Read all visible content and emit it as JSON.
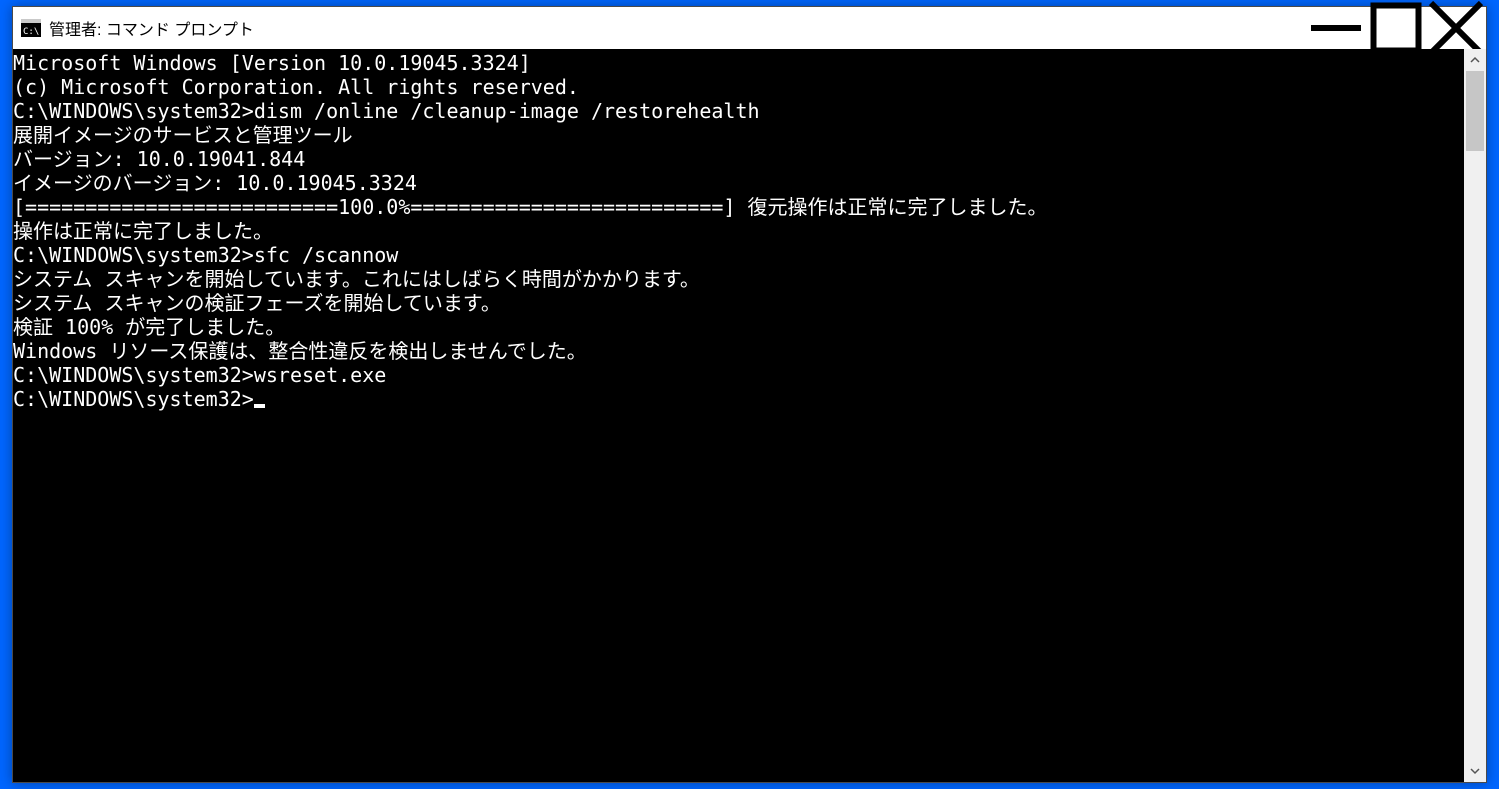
{
  "window": {
    "title": "管理者: コマンド プロンプト"
  },
  "terminal": {
    "lines": [
      "Microsoft Windows [Version 10.0.19045.3324]",
      "(c) Microsoft Corporation. All rights reserved.",
      "",
      "C:\\WINDOWS\\system32>dism /online /cleanup-image /restorehealth",
      "",
      "展開イメージのサービスと管理ツール",
      "バージョン: 10.0.19041.844",
      "",
      "イメージのバージョン: 10.0.19045.3324",
      "",
      "[==========================100.0%==========================] 復元操作は正常に完了しました。",
      "操作は正常に完了しました。",
      "",
      "C:\\WINDOWS\\system32>sfc /scannow",
      "",
      "システム スキャンを開始しています。これにはしばらく時間がかかります。",
      "",
      "システム スキャンの検証フェーズを開始しています。",
      "検証 100% が完了しました。",
      "",
      "Windows リソース保護は、整合性違反を検出しませんでした。",
      "",
      "C:\\WINDOWS\\system32>wsreset.exe",
      "",
      "C:\\WINDOWS\\system32>"
    ],
    "show_cursor_on_last": true
  }
}
